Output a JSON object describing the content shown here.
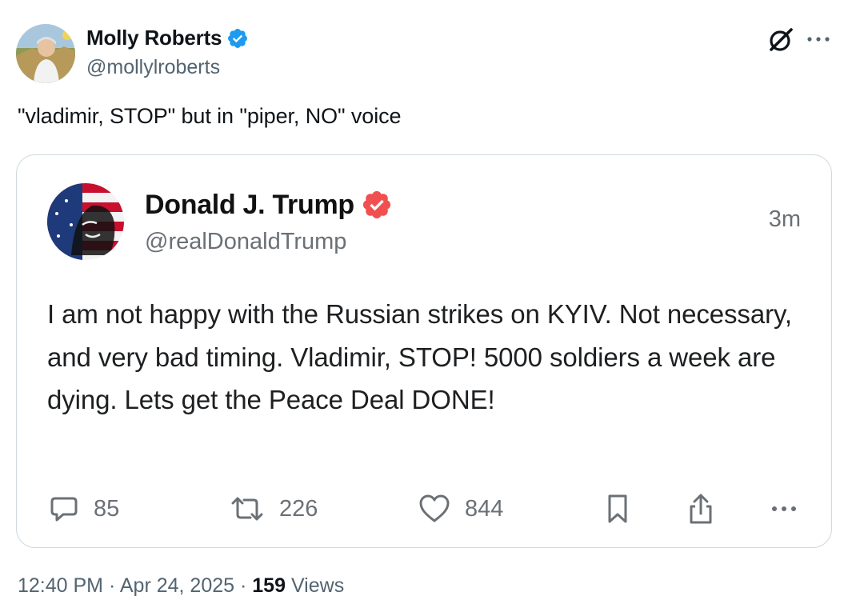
{
  "tweet": {
    "author_name": "Molly Roberts",
    "author_handle": "@mollylroberts",
    "text": "\"vladimir, STOP\" but in \"piper, NO\" voice",
    "time": "12:40 PM",
    "separator": "·",
    "date": "Apr 24, 2025",
    "views_count": "159",
    "views_label": "Views"
  },
  "quote": {
    "author_name": "Donald J. Trump",
    "author_handle": "@realDonaldTrump",
    "time_ago": "3m",
    "body": "I am not happy with the Russian strikes on KYIV. Not necessary, and very bad timing. Vladimir, STOP! 5000 soldiers a week are dying. Lets get the Peace Deal DONE!",
    "replies": "85",
    "reposts": "226",
    "likes": "844"
  },
  "colors": {
    "x_verified": "#1d9bf0",
    "truth_verified": "#f0504f",
    "muted_text": "#536471",
    "card_border": "#cfd9de"
  },
  "icons": [
    "verified-badge-icon",
    "grok-icon",
    "more-icon",
    "reply-icon",
    "repost-icon",
    "like-icon",
    "bookmark-icon",
    "share-icon"
  ]
}
